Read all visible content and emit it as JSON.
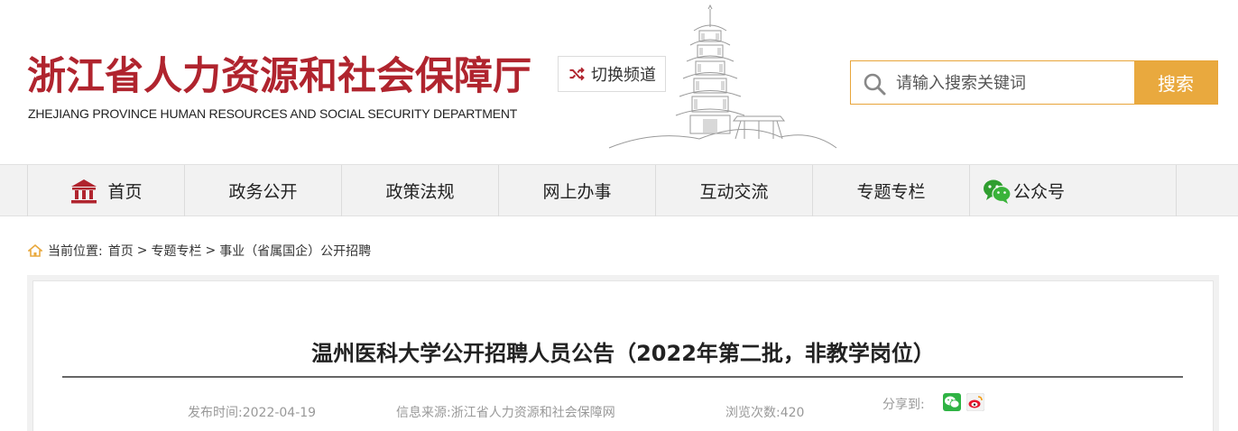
{
  "header": {
    "logo_cn": "浙江省人力资源和社会保障厅",
    "logo_en": "ZHEJIANG PROVINCE HUMAN RESOURCES AND SOCIAL SECURITY DEPARTMENT",
    "switch_channel": "切换频道",
    "search": {
      "placeholder": "请输入搜索关键词",
      "button": "搜索"
    }
  },
  "nav": {
    "items": [
      {
        "label": "首页",
        "icon": "building-icon"
      },
      {
        "label": "政务公开"
      },
      {
        "label": "政策法规"
      },
      {
        "label": "网上办事"
      },
      {
        "label": "互动交流"
      },
      {
        "label": "专题专栏"
      },
      {
        "label": "公众号",
        "icon": "wechat-icon"
      }
    ]
  },
  "breadcrumb": {
    "prefix": "当前位置:",
    "items": [
      "首页",
      "专题专栏",
      "事业（省属国企）公开招聘"
    ],
    "separator": ">"
  },
  "article": {
    "title": "温州医科大学公开招聘人员公告（2022年第二批，非教学岗位）",
    "publish_time": "发布时间:2022-04-19",
    "source": "信息来源:浙江省人力资源和社会保障网",
    "views": "浏览次数:420",
    "share_label": "分享到:"
  },
  "colors": {
    "brand_red": "#b0242e",
    "search_orange": "#e9a93e",
    "nav_bg": "#f2f2f2"
  }
}
